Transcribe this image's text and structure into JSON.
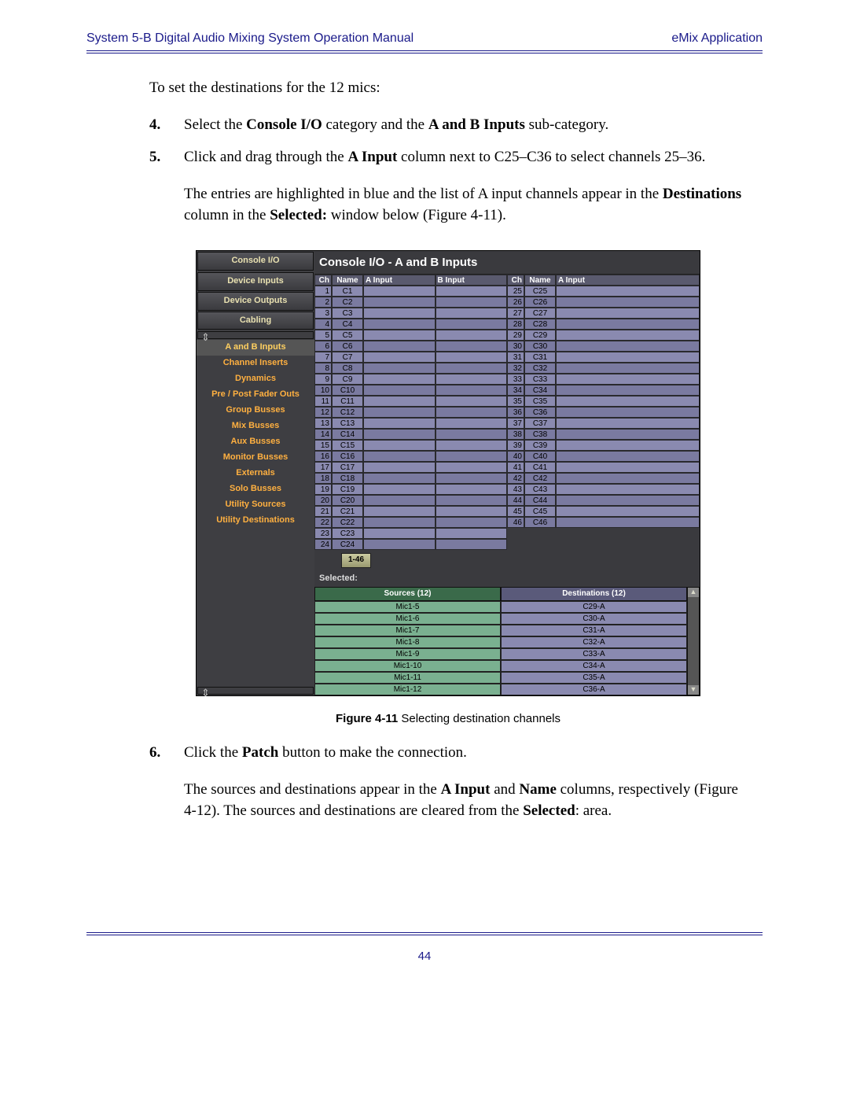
{
  "header": {
    "left": "System 5-B Digital Audio Mixing System Operation Manual",
    "right": "eMix Application"
  },
  "intro": "To set the destinations for the 12 mics:",
  "steps": [
    {
      "num": "4.",
      "html": "Select the <b>Console I/O</b> category and the <b>A and B Inputs</b> sub-category."
    },
    {
      "num": "5.",
      "html": "Click and drag through the <b>A Input</b> column next to C25–C36 to select channels 25–36."
    }
  ],
  "followup5": "The entries are highlighted in blue and the list of A input channels appear in the <b>Destinations</b> column in the <b>Selected:</b> window below (Figure 4-11).",
  "figure": {
    "num": "Figure 4-11",
    "caption": "Selecting destination channels"
  },
  "steps2": [
    {
      "num": "6.",
      "html": "Click the <b>Patch</b> button to make the connection."
    }
  ],
  "followup6": "The sources and destinations appear in the <b>A Input</b> and <b>Name</b> columns, respectively (Figure 4-12). The sources and destinations are cleared from the <b>Selected</b>: area.",
  "pagenum": "44",
  "ss": {
    "sidecat": "Console I/O",
    "sidesubs_top": [
      "Device Inputs",
      "Device Outputs",
      "Cabling"
    ],
    "sidesubs": [
      "A and B Inputs",
      "Channel Inserts",
      "Dynamics",
      "Pre / Post Fader Outs",
      "Group Busses",
      "Mix Busses",
      "Aux Busses",
      "Monitor Busses",
      "Externals",
      "Solo Busses",
      "Utility Sources",
      "Utility Destinations"
    ],
    "title": "Console I/O - A and B Inputs",
    "thead": {
      "ch": "Ch",
      "name": "Name",
      "a": "A Input",
      "b": "B Input"
    },
    "left": [
      {
        "ch": "1",
        "nm": "C1"
      },
      {
        "ch": "2",
        "nm": "C2"
      },
      {
        "ch": "3",
        "nm": "C3"
      },
      {
        "ch": "4",
        "nm": "C4"
      },
      {
        "ch": "5",
        "nm": "C5"
      },
      {
        "ch": "6",
        "nm": "C6"
      },
      {
        "ch": "7",
        "nm": "C7"
      },
      {
        "ch": "8",
        "nm": "C8"
      },
      {
        "ch": "9",
        "nm": "C9"
      },
      {
        "ch": "10",
        "nm": "C10"
      },
      {
        "ch": "11",
        "nm": "C11"
      },
      {
        "ch": "12",
        "nm": "C12"
      },
      {
        "ch": "13",
        "nm": "C13"
      },
      {
        "ch": "14",
        "nm": "C14"
      },
      {
        "ch": "15",
        "nm": "C15"
      },
      {
        "ch": "16",
        "nm": "C16"
      },
      {
        "ch": "17",
        "nm": "C17"
      },
      {
        "ch": "18",
        "nm": "C18"
      },
      {
        "ch": "19",
        "nm": "C19"
      },
      {
        "ch": "20",
        "nm": "C20"
      },
      {
        "ch": "21",
        "nm": "C21"
      },
      {
        "ch": "22",
        "nm": "C22"
      },
      {
        "ch": "23",
        "nm": "C23"
      },
      {
        "ch": "24",
        "nm": "C24"
      }
    ],
    "right": [
      {
        "ch": "25",
        "nm": "C25"
      },
      {
        "ch": "26",
        "nm": "C26"
      },
      {
        "ch": "27",
        "nm": "C27"
      },
      {
        "ch": "28",
        "nm": "C28"
      },
      {
        "ch": "29",
        "nm": "C29"
      },
      {
        "ch": "30",
        "nm": "C30"
      },
      {
        "ch": "31",
        "nm": "C31"
      },
      {
        "ch": "32",
        "nm": "C32"
      },
      {
        "ch": "33",
        "nm": "C33"
      },
      {
        "ch": "34",
        "nm": "C34"
      },
      {
        "ch": "35",
        "nm": "C35"
      },
      {
        "ch": "36",
        "nm": "C36"
      },
      {
        "ch": "37",
        "nm": "C37"
      },
      {
        "ch": "38",
        "nm": "C38"
      },
      {
        "ch": "39",
        "nm": "C39"
      },
      {
        "ch": "40",
        "nm": "C40"
      },
      {
        "ch": "41",
        "nm": "C41"
      },
      {
        "ch": "42",
        "nm": "C42"
      },
      {
        "ch": "43",
        "nm": "C43"
      },
      {
        "ch": "44",
        "nm": "C44"
      },
      {
        "ch": "45",
        "nm": "C45"
      },
      {
        "ch": "46",
        "nm": "C46"
      }
    ],
    "pager": "1-46",
    "selected_label": "Selected:",
    "sel_src_hdr": "Sources (12)",
    "sel_dst_hdr": "Destinations (12)",
    "sel": [
      {
        "s": "Mic1-5",
        "d": "C29-A"
      },
      {
        "s": "Mic1-6",
        "d": "C30-A"
      },
      {
        "s": "Mic1-7",
        "d": "C31-A"
      },
      {
        "s": "Mic1-8",
        "d": "C32-A"
      },
      {
        "s": "Mic1-9",
        "d": "C33-A"
      },
      {
        "s": "Mic1-10",
        "d": "C34-A"
      },
      {
        "s": "Mic1-11",
        "d": "C35-A"
      },
      {
        "s": "Mic1-12",
        "d": "C36-A"
      }
    ]
  }
}
